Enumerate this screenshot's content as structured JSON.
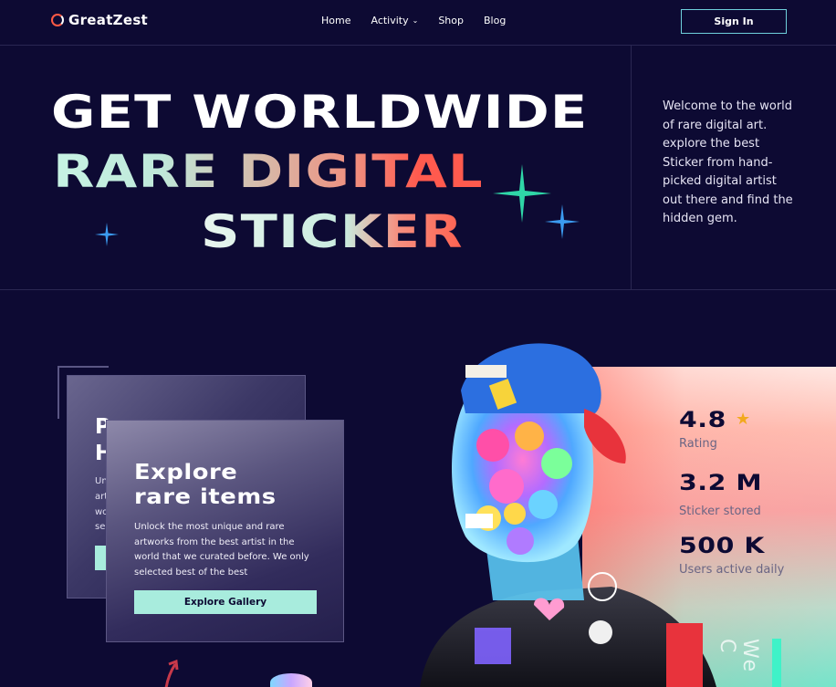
{
  "nav": {
    "brand": "GreatZest",
    "items": [
      {
        "label": "Home"
      },
      {
        "label": "Activity",
        "chevron": "chevron-down-icon"
      },
      {
        "label": "Shop"
      },
      {
        "label": "Blog"
      }
    ],
    "signin_label": "Sign In"
  },
  "hero": {
    "line1": "GET WORLDWIDE",
    "line2": "RARE DIGITAL",
    "line3": "STICKER",
    "welcome": "Welcome to the world of rare digital art. explore the best Sticker from hand-picked digital artist out there and find the hidden gem."
  },
  "gallery_card": {
    "title_line1": "Explore",
    "title_line2": "rare items",
    "text": "Unlock the most unique and rare artworks from the best artist in the world that we curated before. We only selected best of the best",
    "button_label": "Explore Gallery"
  },
  "back_card": {
    "title_line1": "P",
    "title_line2": "H",
    "text_fragments": [
      "Un",
      "art",
      "wo",
      "se"
    ]
  },
  "stats": [
    {
      "value": "4.8",
      "label": "Rating",
      "icon": "star-icon"
    },
    {
      "value": "3.2 M",
      "label": "Sticker stored"
    },
    {
      "value": "500 K",
      "label": "Users active daily"
    }
  ],
  "vertical_text": "We C",
  "colors": {
    "background": "#0d0a33",
    "accent_teal": "#a8ecdd",
    "accent_coral": "#ff5a4e",
    "star": "#f2a91d",
    "sparkle_green": "#2fd6a7",
    "sparkle_blue": "#3b9bf0"
  }
}
